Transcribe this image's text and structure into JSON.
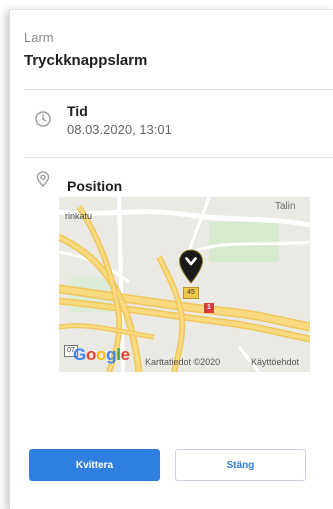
{
  "header": {
    "subtitle": "Larm",
    "title": "Tryckknappslarm"
  },
  "time": {
    "icon": "clock-icon",
    "label": "Tid",
    "value": "08.03.2020, 13:01"
  },
  "position": {
    "icon": "location-pin-outline-icon",
    "label": "Position",
    "map": {
      "street_label": "rinkatu",
      "place_label": "Talin",
      "road_badge_1": "45",
      "road_badge_2": "1",
      "marker_icon": "map-marker-icon",
      "badge_left": "07",
      "logo": "Google",
      "attribution": "Karttatiedot ©2020",
      "terms": "Käyttöehdot"
    }
  },
  "actions": {
    "confirm": "Kvittera",
    "close": "Stäng"
  },
  "colors": {
    "primary": "#2f7fe0",
    "road_yellow": "#f6d36b",
    "marker": "#1a1a1a",
    "badge_red": "#d63b3b"
  }
}
